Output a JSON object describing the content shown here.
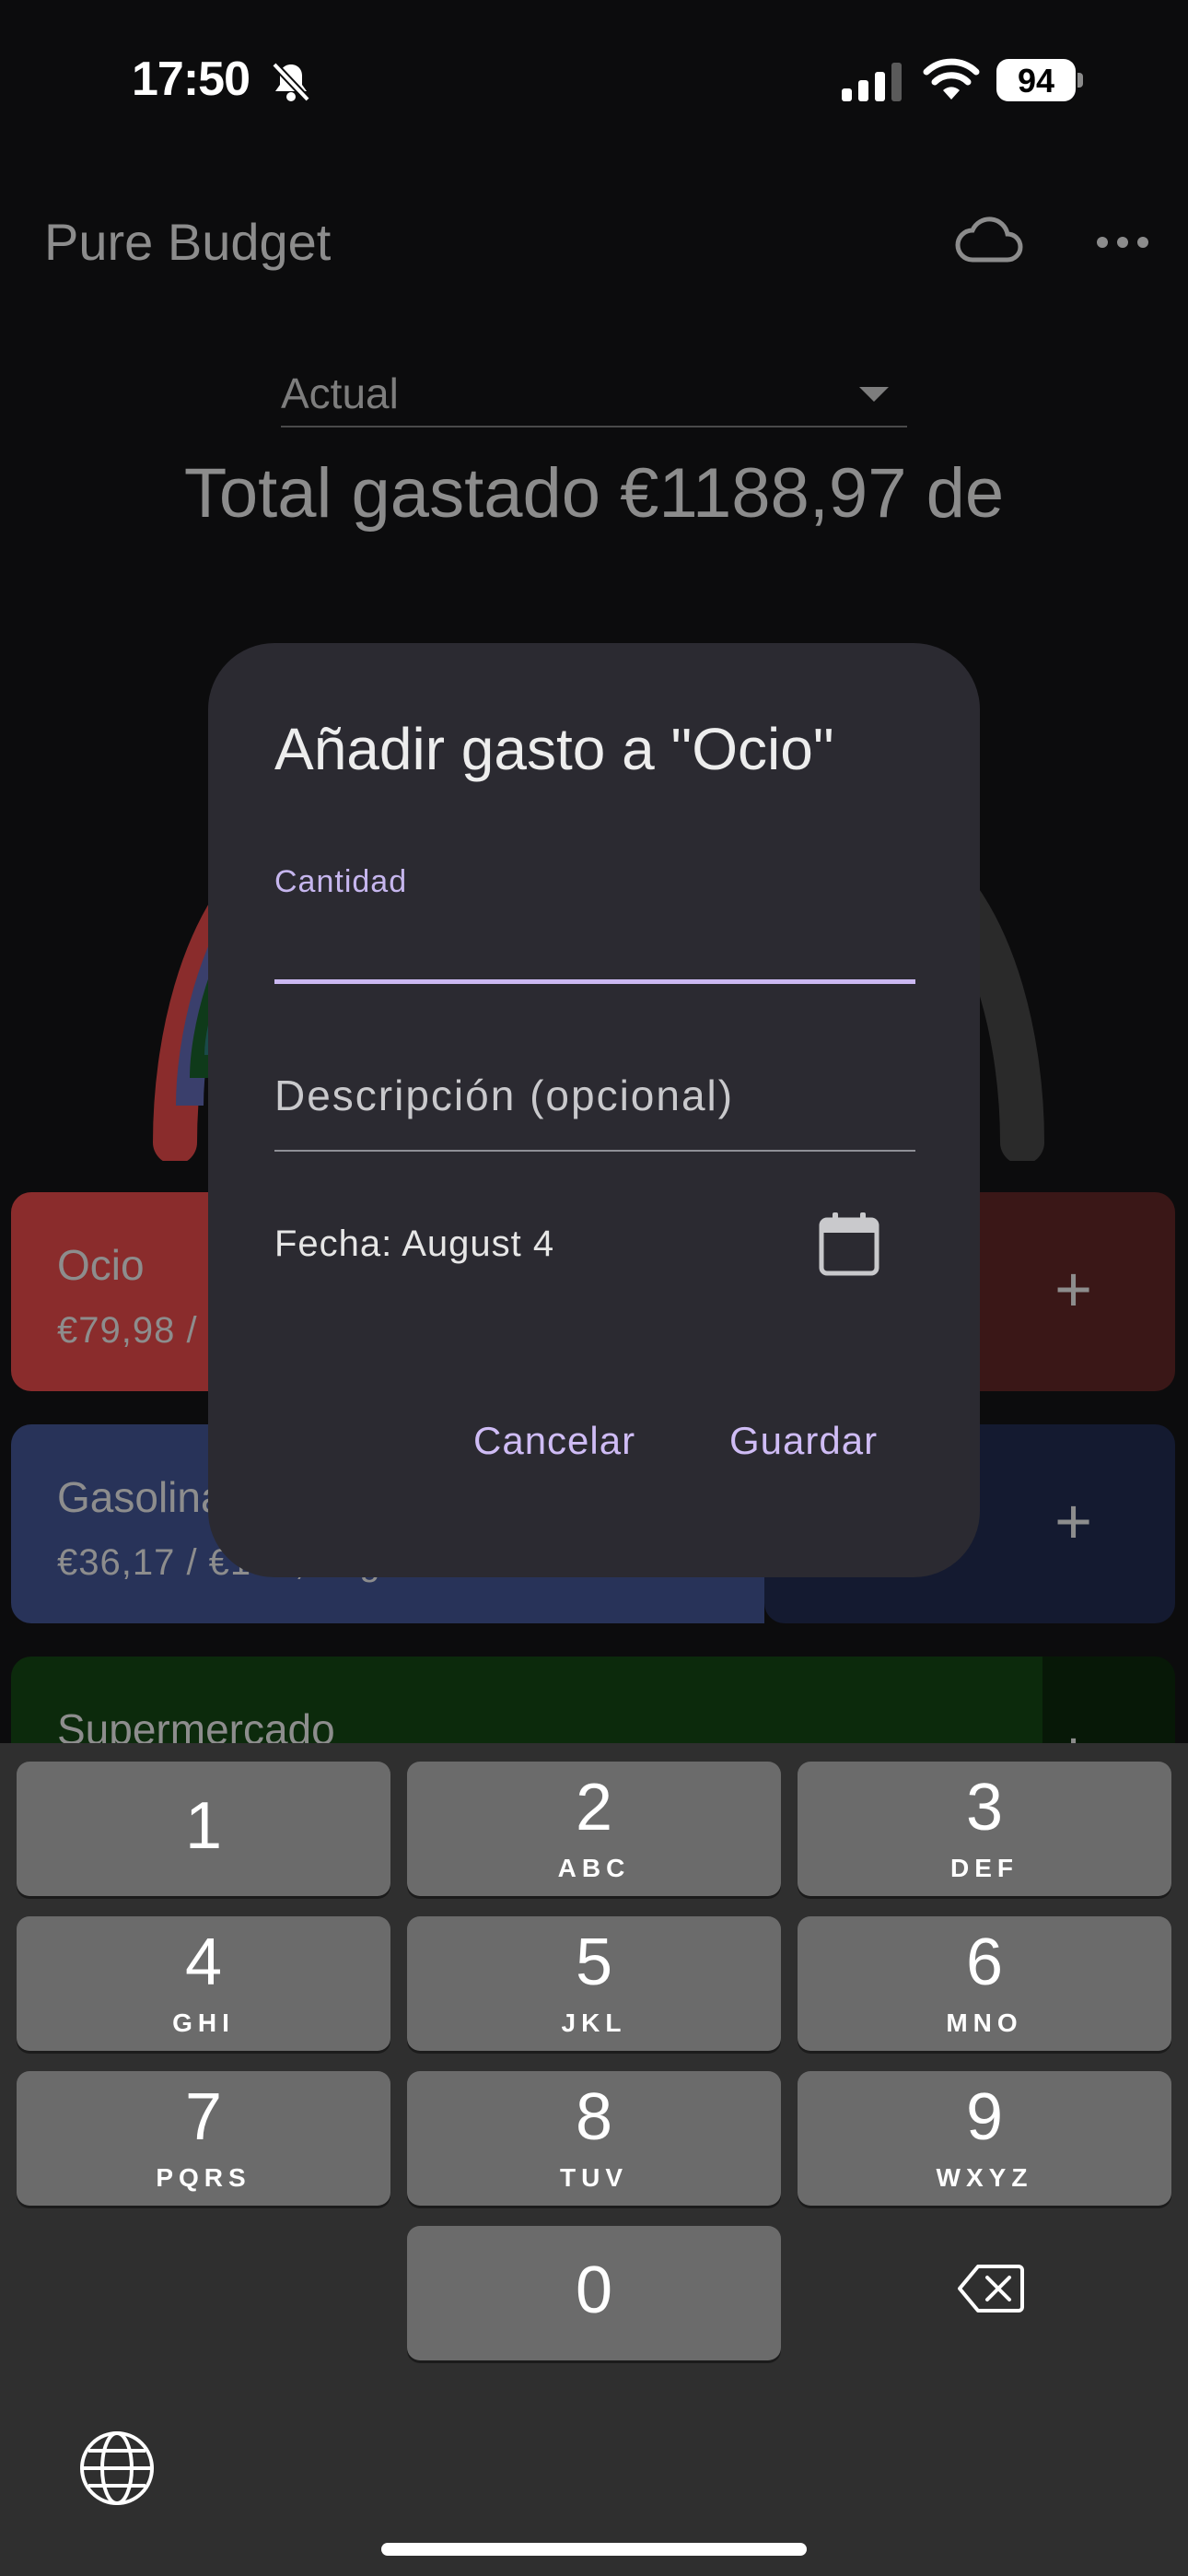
{
  "status_bar": {
    "time": "17:50",
    "battery": "94"
  },
  "app": {
    "title": "Pure Budget",
    "period": "Actual",
    "total_text": "Total gastado €1188,97 de"
  },
  "categories": [
    {
      "name": "Ocio",
      "amount": "€79,98 / €100,00 gastado",
      "color": "#8a2c2c"
    },
    {
      "name": "Gasolina",
      "amount": "€36,17 / €100,00 gastado",
      "color": "#283359"
    },
    {
      "name": "Supermercado",
      "amount": "",
      "color": "#0c2a0c"
    }
  ],
  "dialog": {
    "title": "Añadir gasto a \"Ocio\"",
    "amount_label": "Cantidad",
    "amount_value": "",
    "description_placeholder": "Descripción (opcional)",
    "date_label": "Fecha: August 4",
    "cancel_label": "Cancelar",
    "save_label": "Guardar"
  },
  "keyboard": {
    "keys": [
      {
        "digit": "1",
        "letters": ""
      },
      {
        "digit": "2",
        "letters": "ABC"
      },
      {
        "digit": "3",
        "letters": "DEF"
      },
      {
        "digit": "4",
        "letters": "GHI"
      },
      {
        "digit": "5",
        "letters": "JKL"
      },
      {
        "digit": "6",
        "letters": "MNO"
      },
      {
        "digit": "7",
        "letters": "PQRS"
      },
      {
        "digit": "8",
        "letters": "TUV"
      },
      {
        "digit": "9",
        "letters": "WXYZ"
      },
      {
        "digit": "0",
        "letters": ""
      }
    ]
  },
  "icons": [
    "bell-slash-icon",
    "cellular-signal-icon",
    "wifi-icon",
    "cloud-icon",
    "more-icon",
    "calendar-icon",
    "backspace-icon",
    "globe-icon"
  ]
}
